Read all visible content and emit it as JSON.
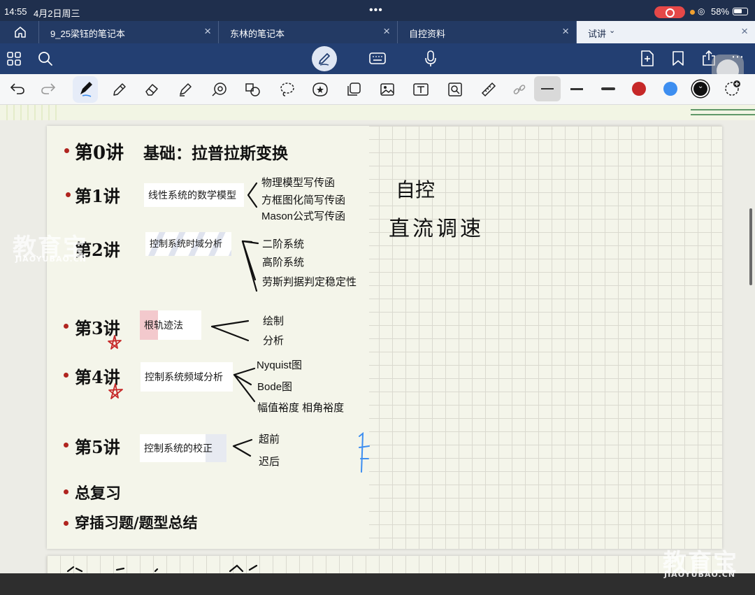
{
  "status": {
    "time": "14:55",
    "date": "4月2日周三",
    "battery": "58%"
  },
  "tabs": [
    {
      "label": "9_25梁钰的笔记本"
    },
    {
      "label": "东林的笔记本"
    },
    {
      "label": "自控资料"
    },
    {
      "label": "试讲"
    }
  ],
  "colors": {
    "red": "#c62828",
    "blue": "#3d8ef0",
    "black": "#111111"
  },
  "note": {
    "lecture0": {
      "title": "第0讲",
      "topic": "基础：拉普拉斯变换"
    },
    "lecture1": {
      "title": "第1讲",
      "box": "线性系统的数学模型",
      "items": [
        "物理模型写传函",
        "方框图化简写传函",
        "Mason公式写传函"
      ]
    },
    "lecture2": {
      "title": "第2讲",
      "box": "控制系统时域分析",
      "items": [
        "二阶系统",
        "高阶系统",
        "劳斯判据判定稳定性"
      ]
    },
    "lecture3": {
      "title": "第3讲",
      "box": "根轨迹法",
      "items": [
        "绘制",
        "分析"
      ]
    },
    "lecture4": {
      "title": "第4讲",
      "box": "控制系统频域分析",
      "items": [
        "Nyquist图",
        "Bode图",
        "幅值裕度 相角裕度"
      ]
    },
    "lecture5": {
      "title": "第5讲",
      "box": "控制系统的校正",
      "items": [
        "超前",
        "迟后"
      ]
    },
    "review": "总复习",
    "misc": "穿插习题/题型总结",
    "side1": "自控",
    "side2": "直流调速"
  },
  "watermark": {
    "logo": "教育宝",
    "url": "JIAOYUBAO.CN"
  }
}
